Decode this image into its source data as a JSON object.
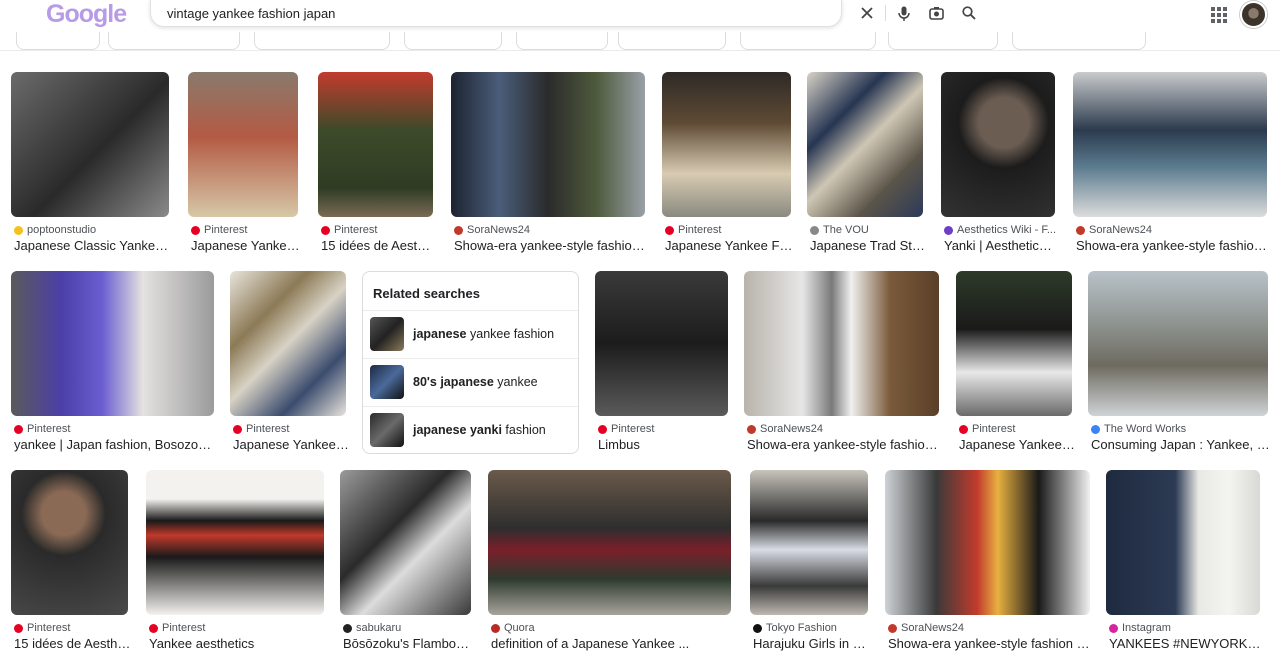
{
  "header": {
    "logo_text": "Google",
    "search_query": "vintage yankee fashion japan",
    "clear_icon": "close-icon",
    "voice_icon": "mic-icon",
    "lens_icon": "camera-lens-icon",
    "search_icon": "search-icon",
    "apps_icon": "apps-grid-icon"
  },
  "results_row1": [
    {
      "source": "poptoonstudio",
      "title": "Japanese Classic Yankee ...",
      "fav_color": "#f5c21b"
    },
    {
      "source": "Pinterest",
      "title": "Japanese Yankee ...",
      "fav_color": "#e60023"
    },
    {
      "source": "Pinterest",
      "title": "15 idées de Aesthe...",
      "fav_color": "#e60023"
    },
    {
      "source": "SoraNews24",
      "title": "Showa-era yankee-style fashion s...",
      "fav_color": "#c0392b"
    },
    {
      "source": "Pinterest",
      "title": "Japanese Yankee Fa...",
      "fav_color": "#e60023"
    },
    {
      "source": "The VOU",
      "title": "Japanese Trad Sty...",
      "fav_color": "#888888"
    },
    {
      "source": "Aesthetics Wiki - F...",
      "title": "Yanki | Aesthetics ...",
      "fav_color": "#6c3fc4"
    },
    {
      "source": "SoraNews24",
      "title": "Showa-era yankee-style fashion s...",
      "fav_color": "#c0392b"
    }
  ],
  "results_row2": [
    {
      "source": "Pinterest",
      "title": "yankee | Japan fashion, Bosozoku ...",
      "fav_color": "#e60023"
    },
    {
      "source": "Pinterest",
      "title": "Japanese Yankee ...",
      "fav_color": "#e60023"
    },
    {
      "source": "Pinterest",
      "title": "Limbus",
      "fav_color": "#e60023"
    },
    {
      "source": "SoraNews24",
      "title": "Showa-era yankee-style fashion s...",
      "fav_color": "#c0392b"
    },
    {
      "source": "Pinterest",
      "title": "Japanese Yankee ...",
      "fav_color": "#e60023"
    },
    {
      "source": "The Word Works",
      "title": "Consuming Japan : Yankee, Ga...",
      "fav_color": "#3b82f6"
    }
  ],
  "results_row3": [
    {
      "source": "Pinterest",
      "title": "15 idées de Aesthe...",
      "fav_color": "#e60023"
    },
    {
      "source": "Pinterest",
      "title": "Yankee aesthetics",
      "fav_color": "#e60023"
    },
    {
      "source": "sabukaru",
      "title": "Bōsōzoku's Flamboya...",
      "fav_color": "#222222"
    },
    {
      "source": "Quora",
      "title": "definition of a Japanese Yankee ...",
      "fav_color": "#b92b27"
    },
    {
      "source": "Tokyo Fashion",
      "title": "Harajuku Girls in S...",
      "fav_color": "#111111"
    },
    {
      "source": "SoraNews24",
      "title": "Showa-era yankee-style fashion sh...",
      "fav_color": "#c0392b"
    },
    {
      "source": "Instagram",
      "title": "YANKEES #NEWYORKYA...",
      "fav_color": "#d6249f"
    }
  ],
  "related": {
    "heading": "Related searches",
    "items": [
      {
        "bold": "japanese",
        "rest": " yankee fashion"
      },
      {
        "pre": "80's ",
        "bold": "japanese",
        "rest": " yankee"
      },
      {
        "bold": "japanese yanki",
        "rest": " fashion"
      }
    ]
  }
}
